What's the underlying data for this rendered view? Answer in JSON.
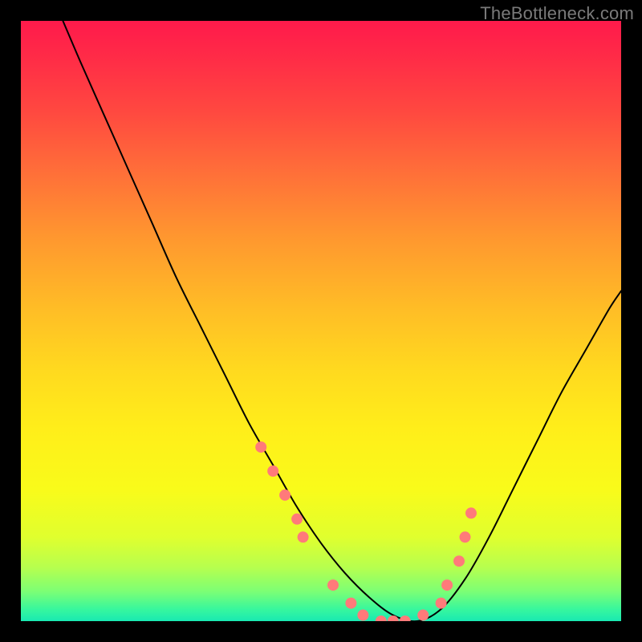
{
  "watermark": "TheBottleneck.com",
  "chart_data": {
    "type": "line",
    "title": "",
    "xlabel": "",
    "ylabel": "",
    "xlim": [
      0,
      100
    ],
    "ylim": [
      0,
      100
    ],
    "grid": false,
    "legend": false,
    "background_gradient": {
      "orientation": "vertical",
      "stops": [
        {
          "pos": 0.0,
          "color": "#ff1a4b"
        },
        {
          "pos": 0.5,
          "color": "#ffd31f"
        },
        {
          "pos": 0.8,
          "color": "#f2ff22"
        },
        {
          "pos": 1.0,
          "color": "#19e9b2"
        }
      ]
    },
    "series": [
      {
        "name": "curve",
        "color": "#000000",
        "width": 2,
        "x": [
          7,
          10,
          14,
          18,
          22,
          26,
          30,
          34,
          38,
          42,
          46,
          50,
          54,
          58,
          62,
          66,
          70,
          74,
          78,
          82,
          86,
          90,
          94,
          98,
          100
        ],
        "y": [
          100,
          93,
          84,
          75,
          66,
          57,
          49,
          41,
          33,
          26,
          19,
          13,
          8,
          4,
          1,
          0,
          2,
          7,
          14,
          22,
          30,
          38,
          45,
          52,
          55
        ]
      },
      {
        "name": "markers",
        "type": "scatter",
        "color": "#ff7a7a",
        "marker_radius": 7,
        "x": [
          40,
          42,
          44,
          46,
          47,
          52,
          55,
          57,
          60,
          62,
          64,
          67,
          70,
          71,
          73,
          74,
          75
        ],
        "y": [
          29,
          25,
          21,
          17,
          14,
          6,
          3,
          1,
          0,
          0,
          0,
          1,
          3,
          6,
          10,
          14,
          18
        ]
      }
    ]
  }
}
